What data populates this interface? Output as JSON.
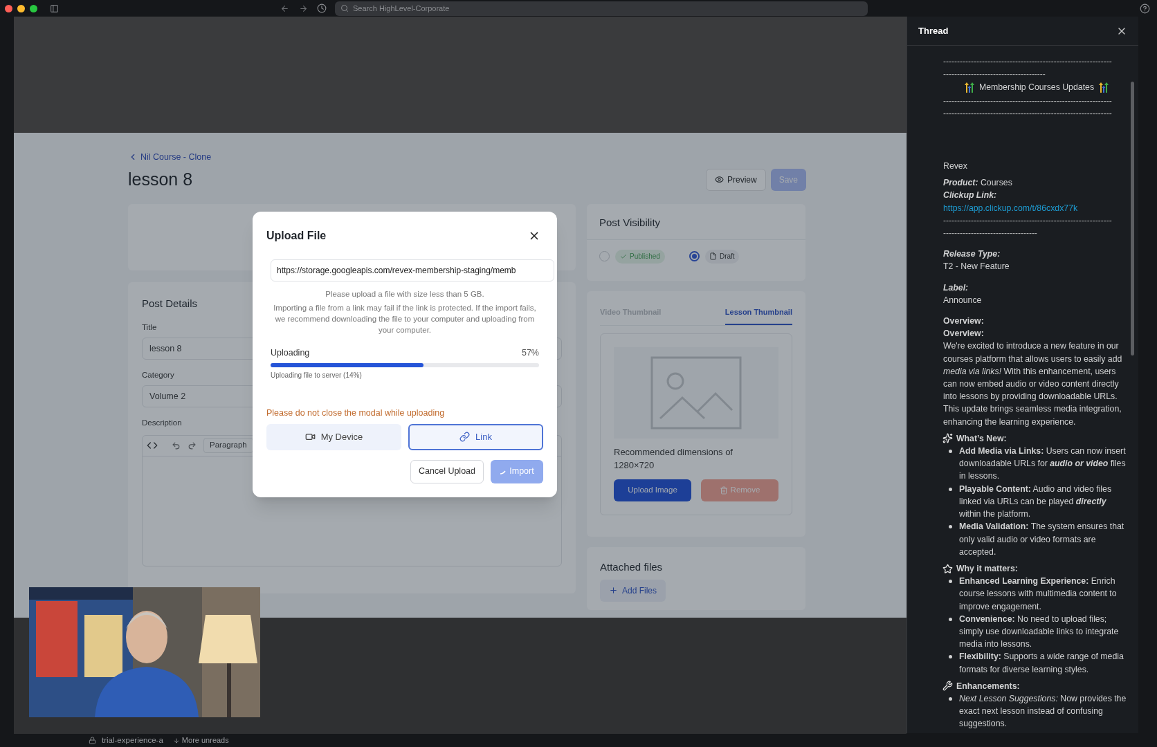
{
  "topbar": {
    "search_placeholder": "Search HighLevel-Corporate"
  },
  "page": {
    "breadcrumb": "Nil Course - Clone",
    "title": "lesson 8",
    "actions": [
      {
        "label": "Preview",
        "kind": "secondary"
      },
      {
        "label": "Save",
        "kind": "primary"
      }
    ],
    "post_details": {
      "heading": "Post Details",
      "fields": [
        {
          "label": "Title",
          "value": "lesson 8"
        },
        {
          "label": "Category",
          "value": "Volume 2"
        }
      ],
      "description": {
        "label": "Description",
        "format": "Paragraph"
      }
    },
    "visibility": {
      "heading": "Post Visibility",
      "options": [
        {
          "label": "Published",
          "kind": "published",
          "selected": false
        },
        {
          "label": "Draft",
          "kind": "draft",
          "selected": true
        }
      ]
    },
    "thumbnail": {
      "tabs": [
        {
          "label": "Video Thumbnail",
          "selected": false
        },
        {
          "label": "Lesson Thumbnail",
          "selected": true
        }
      ],
      "hint": "Recommended dimensions of 1280×720",
      "upload": "Upload Image",
      "remove": "Remove"
    },
    "attached_files": {
      "heading": "Attached files",
      "add": "Add Files"
    }
  },
  "modal": {
    "title": "Upload File",
    "url": "https://storage.googleapis.com/revex-membership-staging/memb",
    "size_note": "Please upload a file with size less than 5 GB.",
    "link_note": "Importing a file from a link may fail if the link is protected. If the import fails, we recommend downloading the file to your computer and uploading from your computer.",
    "progress": {
      "label": "Uploading",
      "reading": "57%",
      "level": 0.57,
      "detail": "Uploading file to server (14%)"
    },
    "warning": "Please do not close the modal while uploading",
    "sources": [
      {
        "label": "My Device",
        "kind": "device",
        "selected": false
      },
      {
        "label": "Link",
        "kind": "link",
        "selected": true
      }
    ],
    "cancel": "Cancel Upload",
    "import": "Import"
  },
  "thread": {
    "title": "Thread",
    "blocks": [
      {
        "kind": "dashes",
        "text": "-------------------------------------------------------------"
      },
      {
        "kind": "dashes",
        "text": "-------------------------------------"
      },
      {
        "kind": "heading",
        "text": "Membership Courses Updates"
      },
      {
        "kind": "dashes",
        "text": "-------------------------------------------------------------"
      },
      {
        "kind": "dashes",
        "text": "-------------------------------------------------------------"
      },
      {
        "kind": "text",
        "text": "Revex"
      },
      {
        "kind": "field_inline",
        "label": "Product:",
        "value": "Courses"
      },
      {
        "kind": "link_field",
        "label": "Clickup Link:",
        "link": "https://app.clickup.com/t/86cxdx77k"
      },
      {
        "kind": "dashes",
        "text": "-------------------------------------------------------------"
      },
      {
        "kind": "dashes",
        "text": "----------------------------------"
      },
      {
        "kind": "field_stacked",
        "label": "Release Type:",
        "value": "T2 - New Feature"
      },
      {
        "kind": "field_stacked",
        "label": "Label:",
        "value": "Announce"
      },
      {
        "kind": "bold",
        "text": "Overview:"
      },
      {
        "kind": "bold",
        "text": "Overview:"
      },
      {
        "kind": "paragraph",
        "text": "We're excited to introduce a new feature in our courses platform that allows users to easily add *media via links!* With this enhancement, users can now embed audio or video content directly into lessons by providing downloadable URLs. This update brings seamless media integration, enhancing the learning experience."
      },
      {
        "kind": "section",
        "text": "What’s New:",
        "items": [
          [
            {
              "text": "Add Media via Links:",
              "bold": true
            },
            {
              "text": " Users can now insert downloadable URLs for "
            },
            {
              "text": "audio or video",
              "bold": true,
              "italic": true
            },
            {
              "text": " files in lessons."
            }
          ],
          [
            {
              "text": "Playable Content:",
              "bold": true
            },
            {
              "text": " Audio and video files linked via URLs can be played "
            },
            {
              "text": "directly",
              "bold": true,
              "italic": true
            },
            {
              "text": " within the platform."
            }
          ],
          [
            {
              "text": "Media Validation:",
              "bold": true
            },
            {
              "text": " The system ensures that only valid audio or video formats are accepted."
            }
          ]
        ]
      },
      {
        "kind": "section",
        "text": "Why it matters:",
        "items": [
          [
            {
              "text": "Enhanced Learning Experience:",
              "bold": true
            },
            {
              "text": " Enrich course lessons with multimedia content to improve engagement."
            }
          ],
          [
            {
              "text": "Convenience:",
              "bold": true
            },
            {
              "text": " No need to upload files; simply use downloadable links to integrate media into lessons."
            }
          ],
          [
            {
              "text": "Flexibility:",
              "bold": true
            },
            {
              "text": " Supports a wide range of media formats for diverse learning styles."
            }
          ]
        ]
      },
      {
        "kind": "section",
        "text": "Enhancements:",
        "items": [
          [
            {
              "text": "Next Lesson Suggestions:",
              "italic": true
            },
            {
              "text": " Now provides the exact next lesson instead of confusing suggestions."
            }
          ]
        ]
      }
    ]
  },
  "bottom_bar": {
    "channel": "trial-experience-a",
    "unreads": "More unreads"
  }
}
